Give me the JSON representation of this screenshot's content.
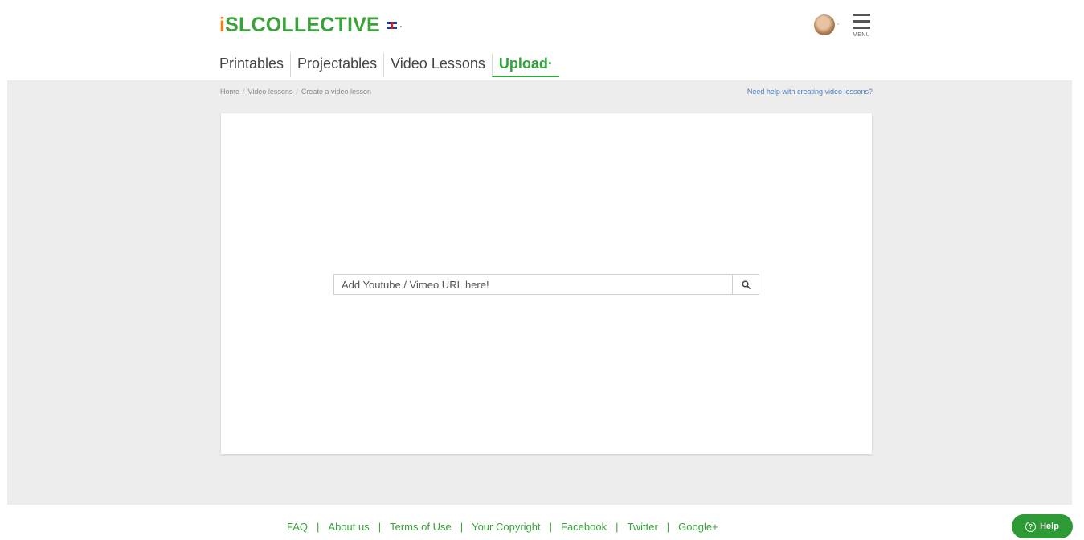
{
  "header": {
    "logo_prefix": "i",
    "logo_rest": "SLCOLLECTIVE",
    "language_caret": "·",
    "avatar_caret": "·",
    "menu_label": "MENU",
    "nav": [
      {
        "label": "Printables"
      },
      {
        "label": "Projectables"
      },
      {
        "label": "Video Lessons"
      },
      {
        "label": "Upload"
      }
    ],
    "upload_caret": "·"
  },
  "breadcrumb": {
    "items": [
      "Home",
      "Video lessons",
      "Create a video lesson"
    ],
    "separator": "/"
  },
  "help_link": "Need help with creating video lessons?",
  "search": {
    "placeholder": "Add Youtube / Vimeo URL here!",
    "value": ""
  },
  "footer": {
    "links": [
      "FAQ",
      "About us",
      "Terms of Use",
      "Your Copyright",
      "Facebook",
      "Twitter",
      "Google+"
    ],
    "separator": "|"
  },
  "help_button": {
    "icon_glyph": "?",
    "label": "Help"
  },
  "colors": {
    "brand_green": "#3ba23b",
    "brand_orange": "#f07d1a",
    "link_blue": "#4a7fc1",
    "background_gray": "#ededed"
  }
}
